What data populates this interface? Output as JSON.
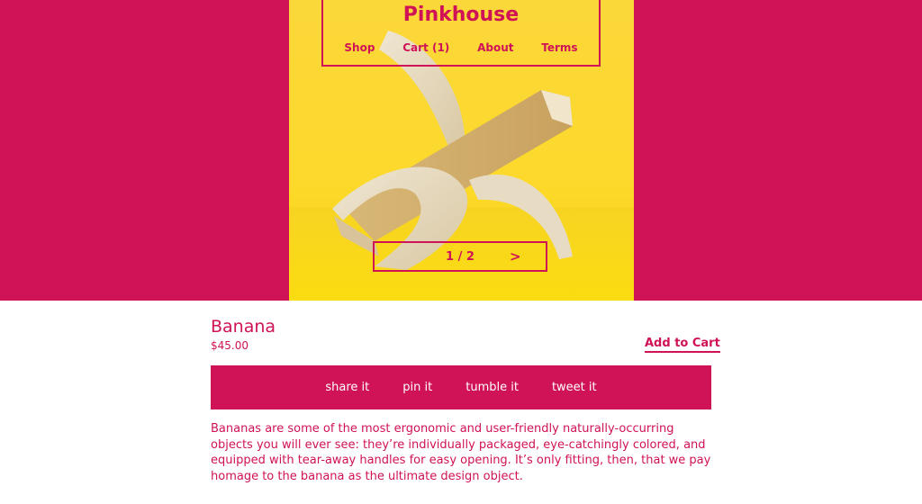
{
  "store": {
    "brand": "Pinkhouse",
    "nav": [
      "Shop",
      "Cart (1)",
      "About",
      "Terms"
    ]
  },
  "slider": {
    "count": "1 / 2",
    "next": ">"
  },
  "product": {
    "name": "Banana",
    "price": "$45.00",
    "add_to_cart": "Add to Cart",
    "description": "Bananas are some of the most ergonomic and user-friendly naturally-occurring objects you will ever see: they’re individually packaged, eye-catchingly colored, and equipped with tear-away handles for easy opening. It’s only fitting, then, that we pay homage to the banana as the ultimate design object."
  },
  "share": [
    "share it",
    "pin it",
    "tumble it",
    "tweet it"
  ],
  "colors": {
    "brand_pink": "#d01257",
    "photo_yellow": "#fcd92b",
    "wood": "#e8ddc4"
  },
  "icons": {
    "photo": "wooden-banana-sculpture"
  }
}
